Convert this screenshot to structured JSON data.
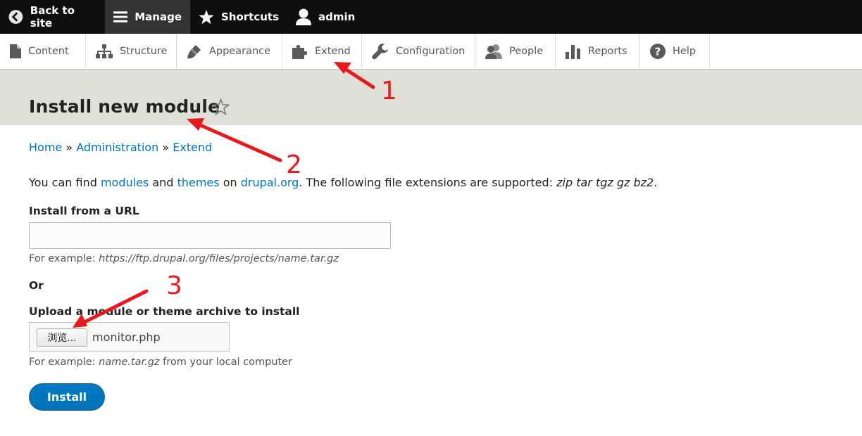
{
  "toolbar": {
    "back": "Back to site",
    "manage": "Manage",
    "shortcuts": "Shortcuts",
    "user": "admin"
  },
  "tray": {
    "items": [
      {
        "label": "Content",
        "icon": "file-icon"
      },
      {
        "label": "Structure",
        "icon": "structure-icon"
      },
      {
        "label": "Appearance",
        "icon": "paintbrush-icon"
      },
      {
        "label": "Extend",
        "icon": "puzzle-icon"
      },
      {
        "label": "Configuration",
        "icon": "wrench-icon"
      },
      {
        "label": "People",
        "icon": "people-icon"
      },
      {
        "label": "Reports",
        "icon": "bar-chart-icon"
      },
      {
        "label": "Help",
        "icon": "help-icon"
      }
    ]
  },
  "page": {
    "title": "Install new module"
  },
  "breadcrumb": {
    "home": "Home",
    "sep": "»",
    "admin": "Administration",
    "extend": "Extend"
  },
  "intro": {
    "prefix": "You can find",
    "modules": "modules",
    "and": "and",
    "themes": "themes",
    "on": "on",
    "drupal": "drupal.org",
    "suffix": ". The following file extensions are supported:",
    "extensions": "zip tar tgz gz bz2",
    "end": "."
  },
  "form": {
    "url_label": "Install from a URL",
    "url_value": "",
    "url_example_prefix": "For example:",
    "url_example": "https://ftp.drupal.org/files/projects/name.tar.gz",
    "or": "Or",
    "upload_label": "Upload a module or theme archive to install",
    "browse_label": "浏览...",
    "file_name": "monitor.php",
    "upload_example_prefix": "For example:",
    "upload_example": "name.tar.gz",
    "upload_example_suffix": "from your local computer",
    "install_label": "Install"
  },
  "annotations": {
    "one": "1",
    "two": "2",
    "three": "3",
    "color": "#e8191c"
  },
  "colors": {
    "toolbar_bg": "#0f0f0f",
    "header_bg": "#e0e0d8",
    "link": "#0074bd",
    "button": "#0074bd"
  }
}
